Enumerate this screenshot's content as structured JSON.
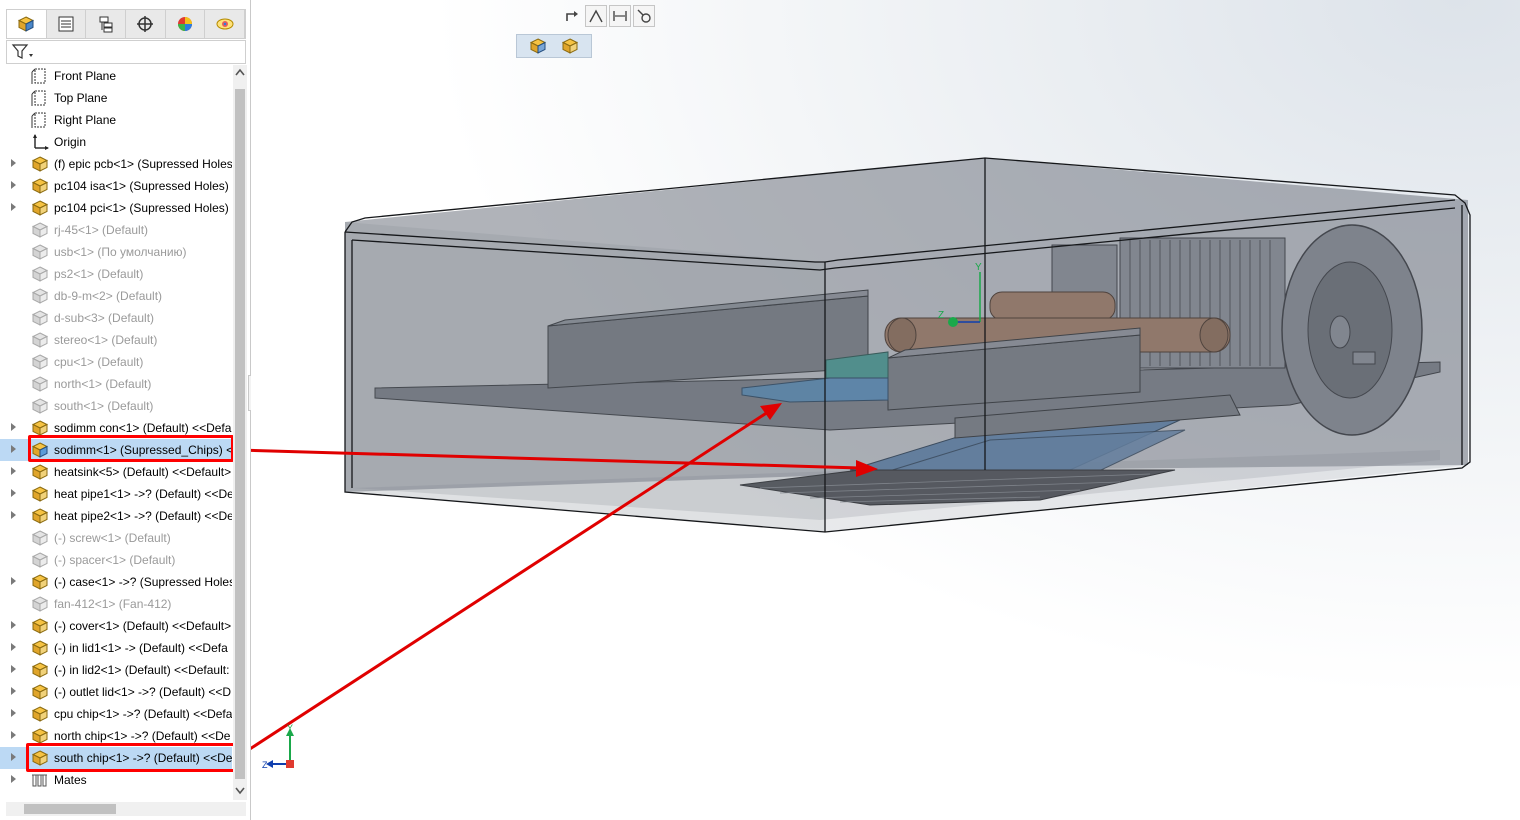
{
  "feature_tree": {
    "items": [
      {
        "label": "Front Plane",
        "icon": "plane-icon",
        "state": "normal",
        "expandable": false
      },
      {
        "label": "Top Plane",
        "icon": "plane-icon",
        "state": "normal",
        "expandable": false
      },
      {
        "label": "Right Plane",
        "icon": "plane-icon",
        "state": "normal",
        "expandable": false
      },
      {
        "label": "Origin",
        "icon": "origin-icon",
        "state": "normal",
        "expandable": false
      },
      {
        "label": "(f) epic pcb<1> (Supressed Holes)",
        "icon": "assembly-icon",
        "state": "normal",
        "expandable": true
      },
      {
        "label": "pc104 isa<1> (Supressed Holes) <",
        "icon": "assembly-icon",
        "state": "normal",
        "expandable": true
      },
      {
        "label": "pc104 pci<1> (Supressed Holes) <",
        "icon": "assembly-icon",
        "state": "normal",
        "expandable": true
      },
      {
        "label": "rj-45<1> (Default)",
        "icon": "assembly-icon",
        "state": "suppressed",
        "expandable": false
      },
      {
        "label": "usb<1> (По умолчанию)",
        "icon": "assembly-icon",
        "state": "suppressed",
        "expandable": false
      },
      {
        "label": "ps2<1> (Default)",
        "icon": "assembly-icon",
        "state": "suppressed",
        "expandable": false
      },
      {
        "label": "db-9-m<2> (Default)",
        "icon": "assembly-icon",
        "state": "suppressed",
        "expandable": false
      },
      {
        "label": "d-sub<3> (Default)",
        "icon": "assembly-icon",
        "state": "suppressed",
        "expandable": false
      },
      {
        "label": "stereo<1> (Default)",
        "icon": "assembly-icon",
        "state": "suppressed",
        "expandable": false
      },
      {
        "label": "cpu<1> (Default)",
        "icon": "assembly-icon",
        "state": "suppressed",
        "expandable": false
      },
      {
        "label": "north<1> (Default)",
        "icon": "assembly-icon",
        "state": "suppressed",
        "expandable": false
      },
      {
        "label": "south<1> (Default)",
        "icon": "assembly-icon",
        "state": "suppressed",
        "expandable": false
      },
      {
        "label": "sodimm con<1> (Default) <<Defa",
        "icon": "assembly-icon",
        "state": "normal",
        "expandable": true
      },
      {
        "label": "sodimm<1> (Supressed_Chips) <",
        "icon": "assembly-icon-blue",
        "state": "selected",
        "expandable": true
      },
      {
        "label": "heatsink<5> (Default) <<Default>",
        "icon": "assembly-icon",
        "state": "normal",
        "expandable": true
      },
      {
        "label": "heat pipe1<1> ->? (Default) <<De",
        "icon": "assembly-icon",
        "state": "normal",
        "expandable": true
      },
      {
        "label": "heat pipe2<1> ->? (Default) <<De",
        "icon": "assembly-icon",
        "state": "normal",
        "expandable": true
      },
      {
        "label": "(-) screw<1> (Default)",
        "icon": "assembly-icon",
        "state": "suppressed",
        "expandable": false
      },
      {
        "label": "(-) spacer<1> (Default)",
        "icon": "assembly-icon",
        "state": "suppressed",
        "expandable": false
      },
      {
        "label": "(-) case<1> ->? (Supressed Holes)",
        "icon": "assembly-icon",
        "state": "normal",
        "expandable": true
      },
      {
        "label": "fan-412<1> (Fan-412)",
        "icon": "assembly-icon",
        "state": "suppressed",
        "expandable": false
      },
      {
        "label": "(-) cover<1> (Default) <<Default>",
        "icon": "assembly-icon",
        "state": "normal",
        "expandable": true
      },
      {
        "label": "(-) in lid1<1> -> (Default) <<Defa",
        "icon": "assembly-icon",
        "state": "normal",
        "expandable": true
      },
      {
        "label": "(-) in lid2<1> (Default) <<Default:",
        "icon": "assembly-icon",
        "state": "normal",
        "expandable": true
      },
      {
        "label": "(-) outlet lid<1> ->? (Default) <<D",
        "icon": "assembly-icon",
        "state": "normal",
        "expandable": true
      },
      {
        "label": "cpu chip<1> ->? (Default) <<Defa",
        "icon": "assembly-icon",
        "state": "normal",
        "expandable": true
      },
      {
        "label": "north chip<1> ->? (Default) <<De",
        "icon": "assembly-icon",
        "state": "normal",
        "expandable": true
      },
      {
        "label": "south chip<1> ->? (Default) <<De",
        "icon": "assembly-icon",
        "state": "selected",
        "expandable": true
      },
      {
        "label": "Mates",
        "icon": "mates-icon",
        "state": "normal",
        "expandable": true
      }
    ]
  },
  "tabs": [
    {
      "icon": "feature-manager-icon",
      "active": true
    },
    {
      "icon": "property-manager-icon",
      "active": false
    },
    {
      "icon": "configuration-manager-icon",
      "active": false
    },
    {
      "icon": "dimxpert-icon",
      "active": false
    },
    {
      "icon": "display-manager-icon",
      "active": false
    },
    {
      "icon": "appearance-icon",
      "active": false
    }
  ],
  "colors": {
    "highlight": "#ff0000",
    "selection": "#bcd9f4",
    "suppressed_text": "#9a9a9a"
  },
  "triad_axes": {
    "y": "Y",
    "z": "Z"
  }
}
